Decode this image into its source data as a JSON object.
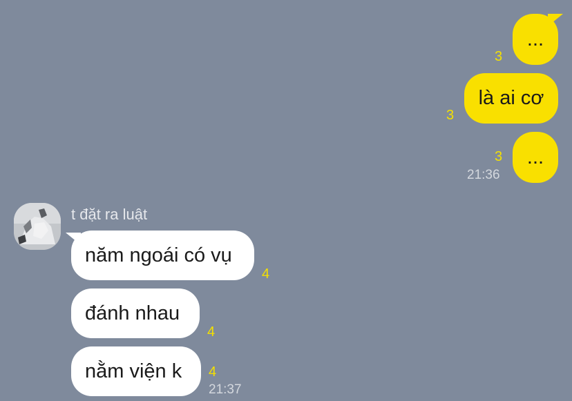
{
  "outgoing": [
    {
      "text": "...",
      "unread": "3"
    },
    {
      "text": "là ai cơ",
      "unread": "3"
    },
    {
      "text": "...",
      "unread": "3",
      "time": "21:36"
    }
  ],
  "incoming": {
    "sender": "t đặt ra luật",
    "messages": [
      {
        "text": "năm ngoái có vụ",
        "unread": "4"
      },
      {
        "text": "đánh nhau",
        "unread": "4"
      },
      {
        "text": "nằm viện k",
        "unread": "4",
        "time": "21:37"
      }
    ]
  },
  "colors": {
    "background": "#7f8a9c",
    "outgoing_bubble": "#f9e000",
    "incoming_bubble": "#ffffff",
    "unread_count": "#f4e000",
    "timestamp": "#d4d8de"
  }
}
